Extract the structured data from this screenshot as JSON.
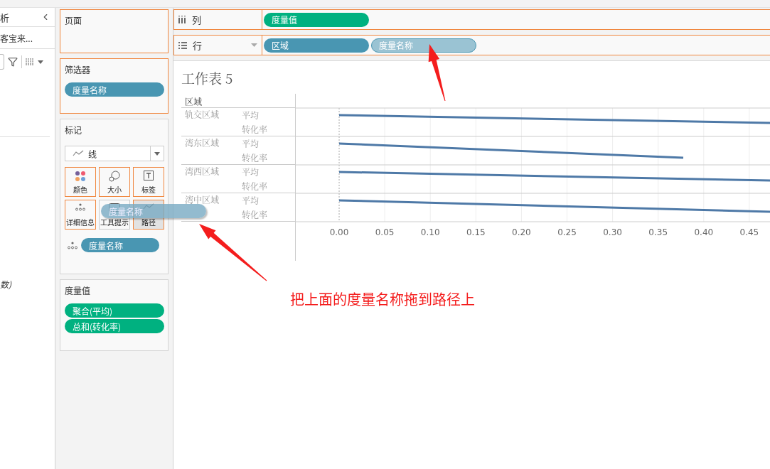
{
  "left_pane": {
    "title": "析",
    "source": "客宝来...",
    "footer_item": "数)"
  },
  "pages_card": {
    "title": "页面",
    "highlighted": true
  },
  "filters_card": {
    "title": "筛选器",
    "highlighted": true,
    "pills": [
      {
        "label": "度量名称",
        "kind": "dimension"
      }
    ]
  },
  "marks_card": {
    "title": "标记",
    "highlighted": false,
    "mark_type": "线",
    "buttons": [
      {
        "label": "颜色",
        "kind": "color",
        "highlighted": true,
        "hovered": false
      },
      {
        "label": "大小",
        "kind": "size",
        "highlighted": true,
        "hovered": false
      },
      {
        "label": "标签",
        "kind": "label",
        "highlighted": true,
        "hovered": false
      },
      {
        "label": "详细信息",
        "kind": "detail",
        "highlighted": true,
        "hovered": false
      },
      {
        "label": "工具提示",
        "kind": "tooltip",
        "highlighted": false,
        "hovered": false
      },
      {
        "label": "路径",
        "kind": "path",
        "highlighted": true,
        "hovered": true
      }
    ],
    "detail_pills": [
      {
        "label": "度量名称",
        "kind": "dimension"
      }
    ]
  },
  "measure_values_card": {
    "title": "度量值",
    "highlighted": false,
    "pills": [
      {
        "label": "聚合(平均)",
        "kind": "measure"
      },
      {
        "label": "总和(转化率)",
        "kind": "measure"
      }
    ]
  },
  "columns_shelf": {
    "label": "列",
    "highlighted": true,
    "pills": [
      {
        "label": "度量值",
        "kind": "measure",
        "ghost": false
      }
    ]
  },
  "rows_shelf": {
    "label": "行",
    "highlighted": true,
    "pills": [
      {
        "label": "区域",
        "kind": "dimension",
        "ghost": false
      },
      {
        "label": "度量名称",
        "kind": "dimension",
        "ghost": true
      }
    ]
  },
  "dragged_pill": {
    "label": "度量名称"
  },
  "worksheet": {
    "title": "工作表 5",
    "row_header": "区域",
    "rows": [
      {
        "region": "轨交区域",
        "measures": [
          "平均",
          "转化率"
        ]
      },
      {
        "region": "湾东区域",
        "measures": [
          "平均",
          "转化率"
        ]
      },
      {
        "region": "湾西区域",
        "measures": [
          "平均",
          "转化率"
        ]
      },
      {
        "region": "湾中区域",
        "measures": [
          "平均",
          "转化率"
        ]
      }
    ],
    "axis_ticks": [
      "0.00",
      "0.05",
      "0.10",
      "0.15",
      "0.20",
      "0.25",
      "0.30",
      "0.35",
      "0.40",
      "0.45"
    ]
  },
  "annotation": {
    "text": "把上面的度量名称拖到路径上"
  }
}
